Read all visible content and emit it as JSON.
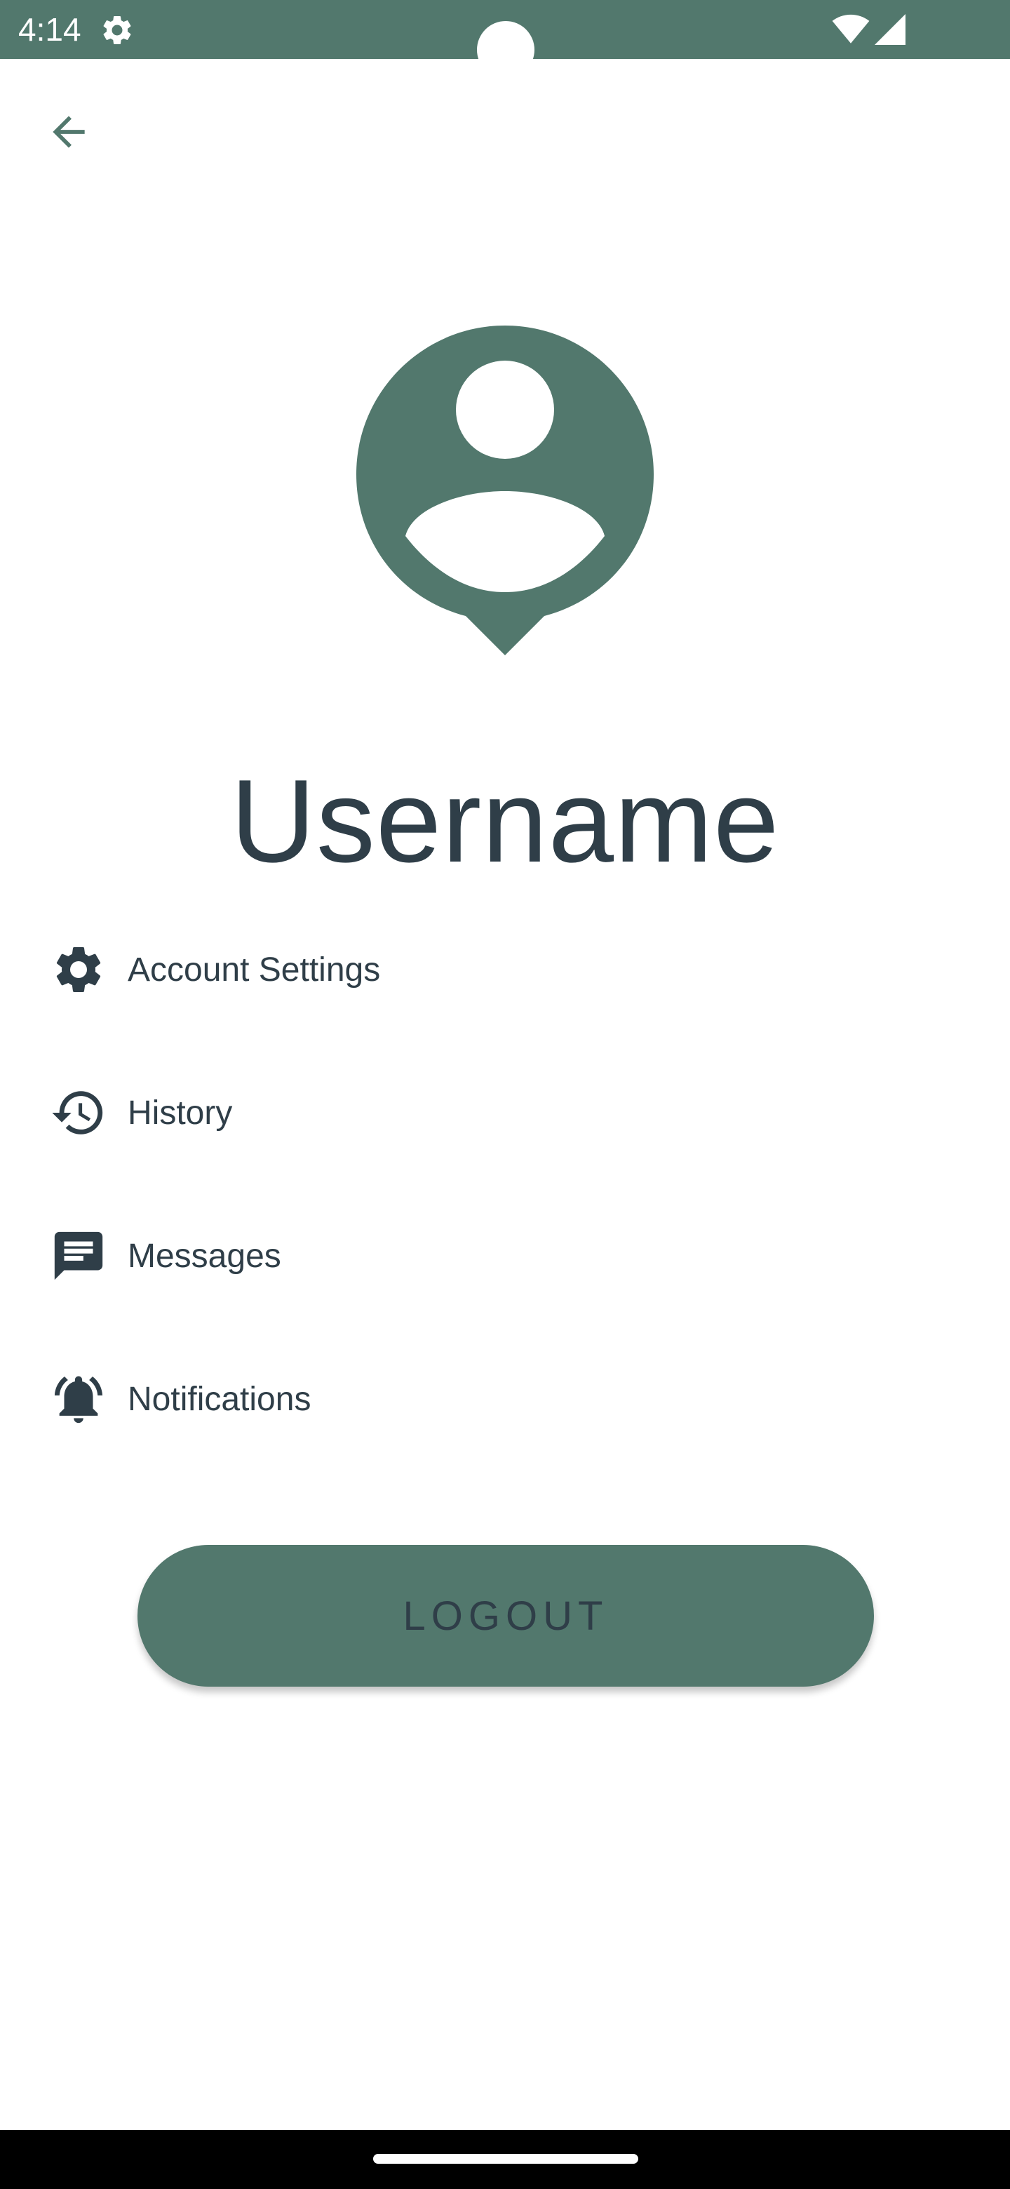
{
  "status_bar": {
    "time": "4:14"
  },
  "profile": {
    "username": "Username"
  },
  "menu": {
    "items": [
      {
        "label": "Account Settings",
        "icon": "gear-icon"
      },
      {
        "label": "History",
        "icon": "history-icon"
      },
      {
        "label": "Messages",
        "icon": "message-icon"
      },
      {
        "label": "Notifications",
        "icon": "notification-bell-icon"
      }
    ]
  },
  "actions": {
    "logout_label": "LOGOUT"
  },
  "colors": {
    "primary": "#52786d",
    "text": "#2f3e48",
    "background": "#ffffff"
  }
}
